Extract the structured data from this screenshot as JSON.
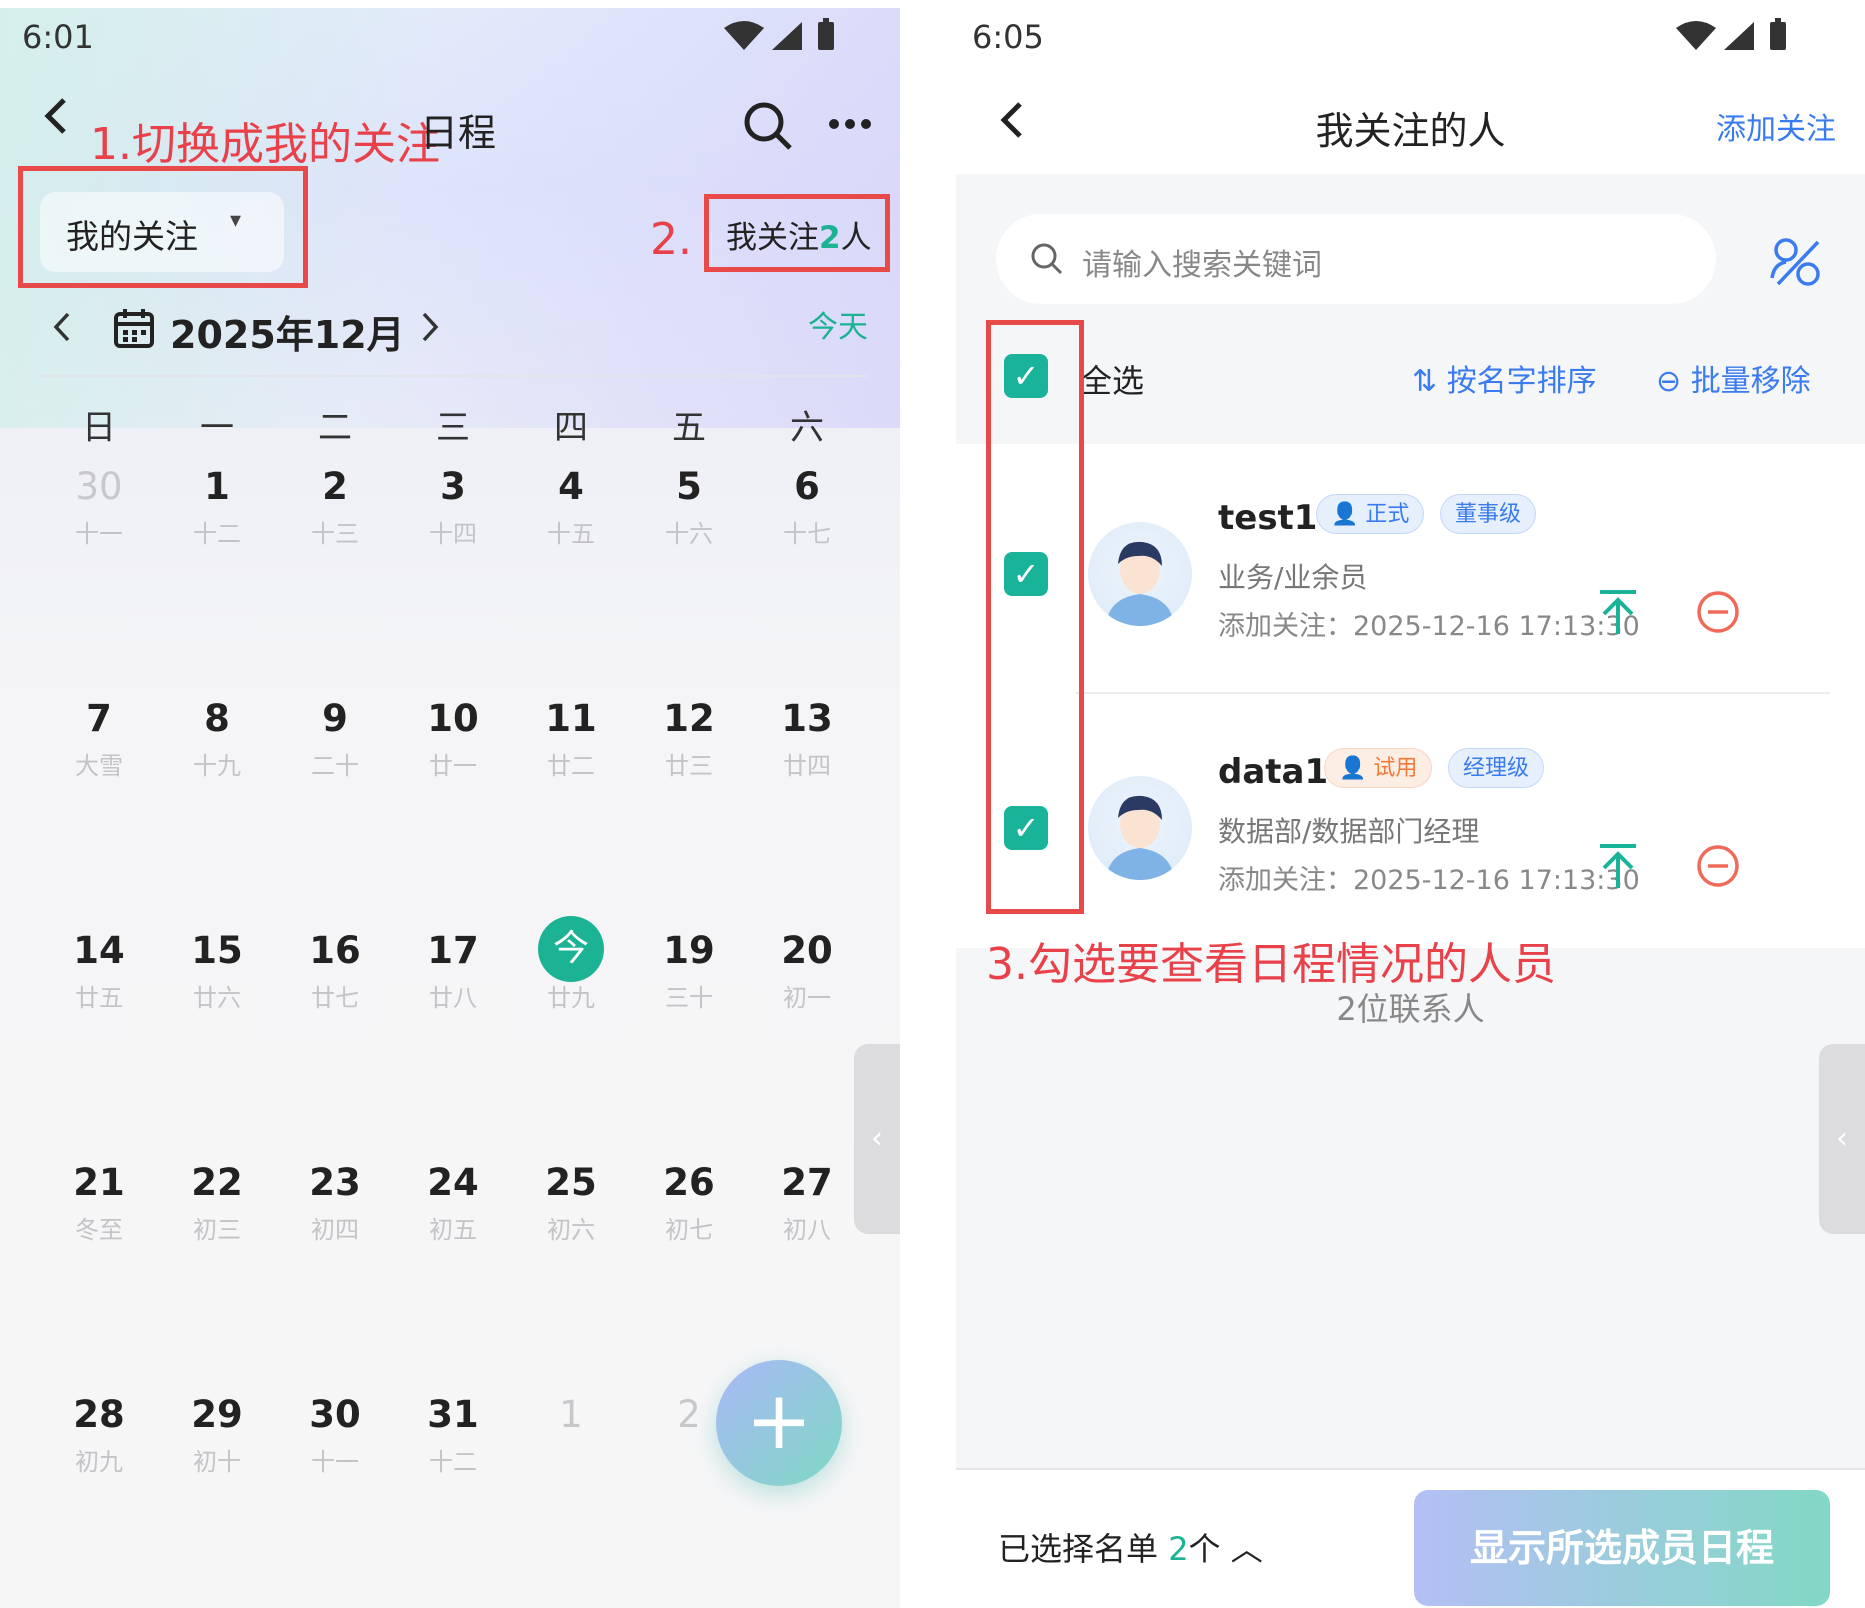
{
  "left": {
    "status_time": "6:01",
    "title": "日程",
    "annotation1": "1.切换成我的关注",
    "annotation2": "2.",
    "filter_label": "我的关注",
    "follow_prefix": "我关注",
    "follow_count": "2",
    "follow_suffix": "人",
    "month_label": "2025年12月",
    "today_label": "今天",
    "weekdays": [
      "日",
      "一",
      "二",
      "三",
      "四",
      "五",
      "六"
    ],
    "weeks": [
      [
        {
          "n": "30",
          "l": "十一",
          "other": true
        },
        {
          "n": "1",
          "l": "十二"
        },
        {
          "n": "2",
          "l": "十三"
        },
        {
          "n": "3",
          "l": "十四"
        },
        {
          "n": "4",
          "l": "十五"
        },
        {
          "n": "5",
          "l": "十六"
        },
        {
          "n": "6",
          "l": "十七"
        }
      ],
      [
        {
          "n": "7",
          "l": "大雪"
        },
        {
          "n": "8",
          "l": "十九"
        },
        {
          "n": "9",
          "l": "二十"
        },
        {
          "n": "10",
          "l": "廿一"
        },
        {
          "n": "11",
          "l": "廿二"
        },
        {
          "n": "12",
          "l": "廿三"
        },
        {
          "n": "13",
          "l": "廿四"
        }
      ],
      [
        {
          "n": "14",
          "l": "廿五"
        },
        {
          "n": "15",
          "l": "廿六"
        },
        {
          "n": "16",
          "l": "廿七"
        },
        {
          "n": "17",
          "l": "廿八"
        },
        {
          "n": "今",
          "l": "廿九",
          "today": true
        },
        {
          "n": "19",
          "l": "三十"
        },
        {
          "n": "20",
          "l": "初一"
        }
      ],
      [
        {
          "n": "21",
          "l": "冬至"
        },
        {
          "n": "22",
          "l": "初三"
        },
        {
          "n": "23",
          "l": "初四"
        },
        {
          "n": "24",
          "l": "初五"
        },
        {
          "n": "25",
          "l": "初六"
        },
        {
          "n": "26",
          "l": "初七"
        },
        {
          "n": "27",
          "l": "初八"
        }
      ],
      [
        {
          "n": "28",
          "l": "初九"
        },
        {
          "n": "29",
          "l": "初十"
        },
        {
          "n": "30",
          "l": "十一"
        },
        {
          "n": "31",
          "l": "十二"
        },
        {
          "n": "1",
          "l": "",
          "other": true
        },
        {
          "n": "2",
          "l": "",
          "other": true
        },
        {
          "n": "",
          "l": ""
        }
      ]
    ],
    "fab_label": "+"
  },
  "right": {
    "status_time": "6:05",
    "title": "我关注的人",
    "add_follow": "添加关注",
    "search_placeholder": "请输入搜索关键词",
    "select_all": "全选",
    "sort_label": "按名字排序",
    "batch_remove": "批量移除",
    "contacts": [
      {
        "name": "test1",
        "type_tag": "正式",
        "level_tag": "董事级",
        "dept": "业务/业余员",
        "added": "添加关注：2025-12-16 17:13:30"
      },
      {
        "name": "data1",
        "type_tag": "试用",
        "level_tag": "经理级",
        "dept": "数据部/数据部门经理",
        "added": "添加关注：2025-12-16 17:13:30"
      }
    ],
    "annotation3": "3.勾选要查看日程情况的人员",
    "contact_count": "2位联系人",
    "selected_prefix": "已选择名单",
    "selected_count": "2",
    "selected_suffix": "个",
    "show_button": "显示所选成员日程"
  },
  "colors": {
    "accent": "#1bb394",
    "link": "#3a7bf0",
    "annotation": "#e8414a",
    "trial": "#f07a3a"
  }
}
